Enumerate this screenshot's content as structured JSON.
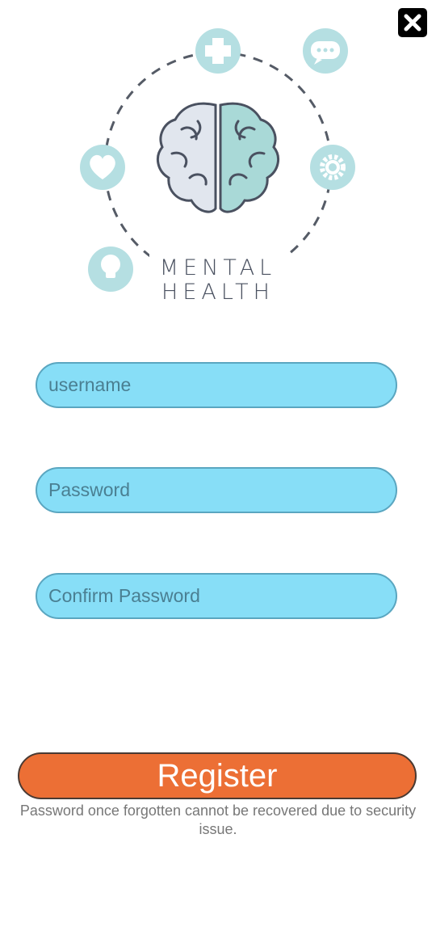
{
  "app": {
    "close_icon": "close-icon"
  },
  "logo": {
    "line1": "MENTAL",
    "line2": "HEALTH",
    "icons": [
      "plus-icon",
      "chat-icon",
      "heart-icon",
      "gear-icon",
      "lightbulb-icon",
      "brain-icon"
    ],
    "accent_color": "#b5dfe2",
    "brain_outline_color": "#4a5160"
  },
  "form": {
    "username_placeholder": "username",
    "password_placeholder": "Password",
    "confirm_placeholder": "Confirm Password",
    "field_color": "#87def7"
  },
  "register": {
    "label": "Register",
    "color": "#ec6f35"
  },
  "note": {
    "text": "Password once forgotten cannot be recovered due to security issue."
  }
}
